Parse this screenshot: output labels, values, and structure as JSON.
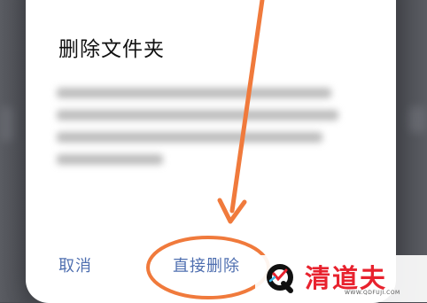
{
  "dialog": {
    "title": "删除文件夹",
    "cancel_label": "取消",
    "delete_label": "直接删除"
  },
  "watermark": {
    "brand": "清道夫",
    "url": "WWW.QDFUJI.COM"
  },
  "colors": {
    "annotation": "#f07a3c",
    "action_text": "#4f6fb0",
    "brand_red": "#e8222e"
  }
}
